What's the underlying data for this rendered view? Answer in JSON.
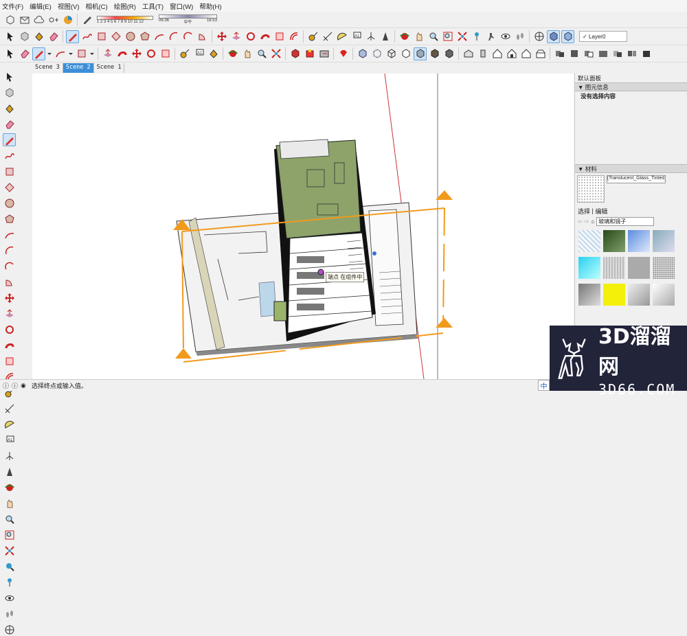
{
  "menu": [
    "文件(F)",
    "编辑(E)",
    "视图(V)",
    "相机(C)",
    "绘图(R)",
    "工具(T)",
    "窗口(W)",
    "帮助(H)"
  ],
  "scale": {
    "left_nums": "1 2 3 4 5 6 7 8 9 10 11 12",
    "mid_time1": "06:36",
    "mid_label": "中午",
    "mid_time2": "16:53"
  },
  "layer": {
    "checked": "✓",
    "name": "Layer0"
  },
  "scene_tabs": [
    "Scene 3",
    "Scene 2",
    "Scene 1"
  ],
  "active_scene": "Scene 2",
  "tooltip": "端点 在组件中",
  "panel": {
    "title": "默认面板",
    "entity_info": {
      "header": "图元信息",
      "status": "没有选择内容"
    },
    "materials": {
      "header": "材料",
      "current_name": "[Translucent_Glass_Tinted_",
      "tab_select": "选择",
      "tab_edit": "编辑",
      "collection": "玻璃和镜子"
    }
  },
  "status": {
    "hint": "选择终点或输入值。",
    "ime": "中"
  },
  "watermark": {
    "brand": "3D溜溜网",
    "url": "3D66.COM"
  },
  "colors": {
    "accent": "#3d8fd8",
    "orange": "#f29a1c",
    "red": "#d22",
    "wm_bg": "#22243a"
  }
}
